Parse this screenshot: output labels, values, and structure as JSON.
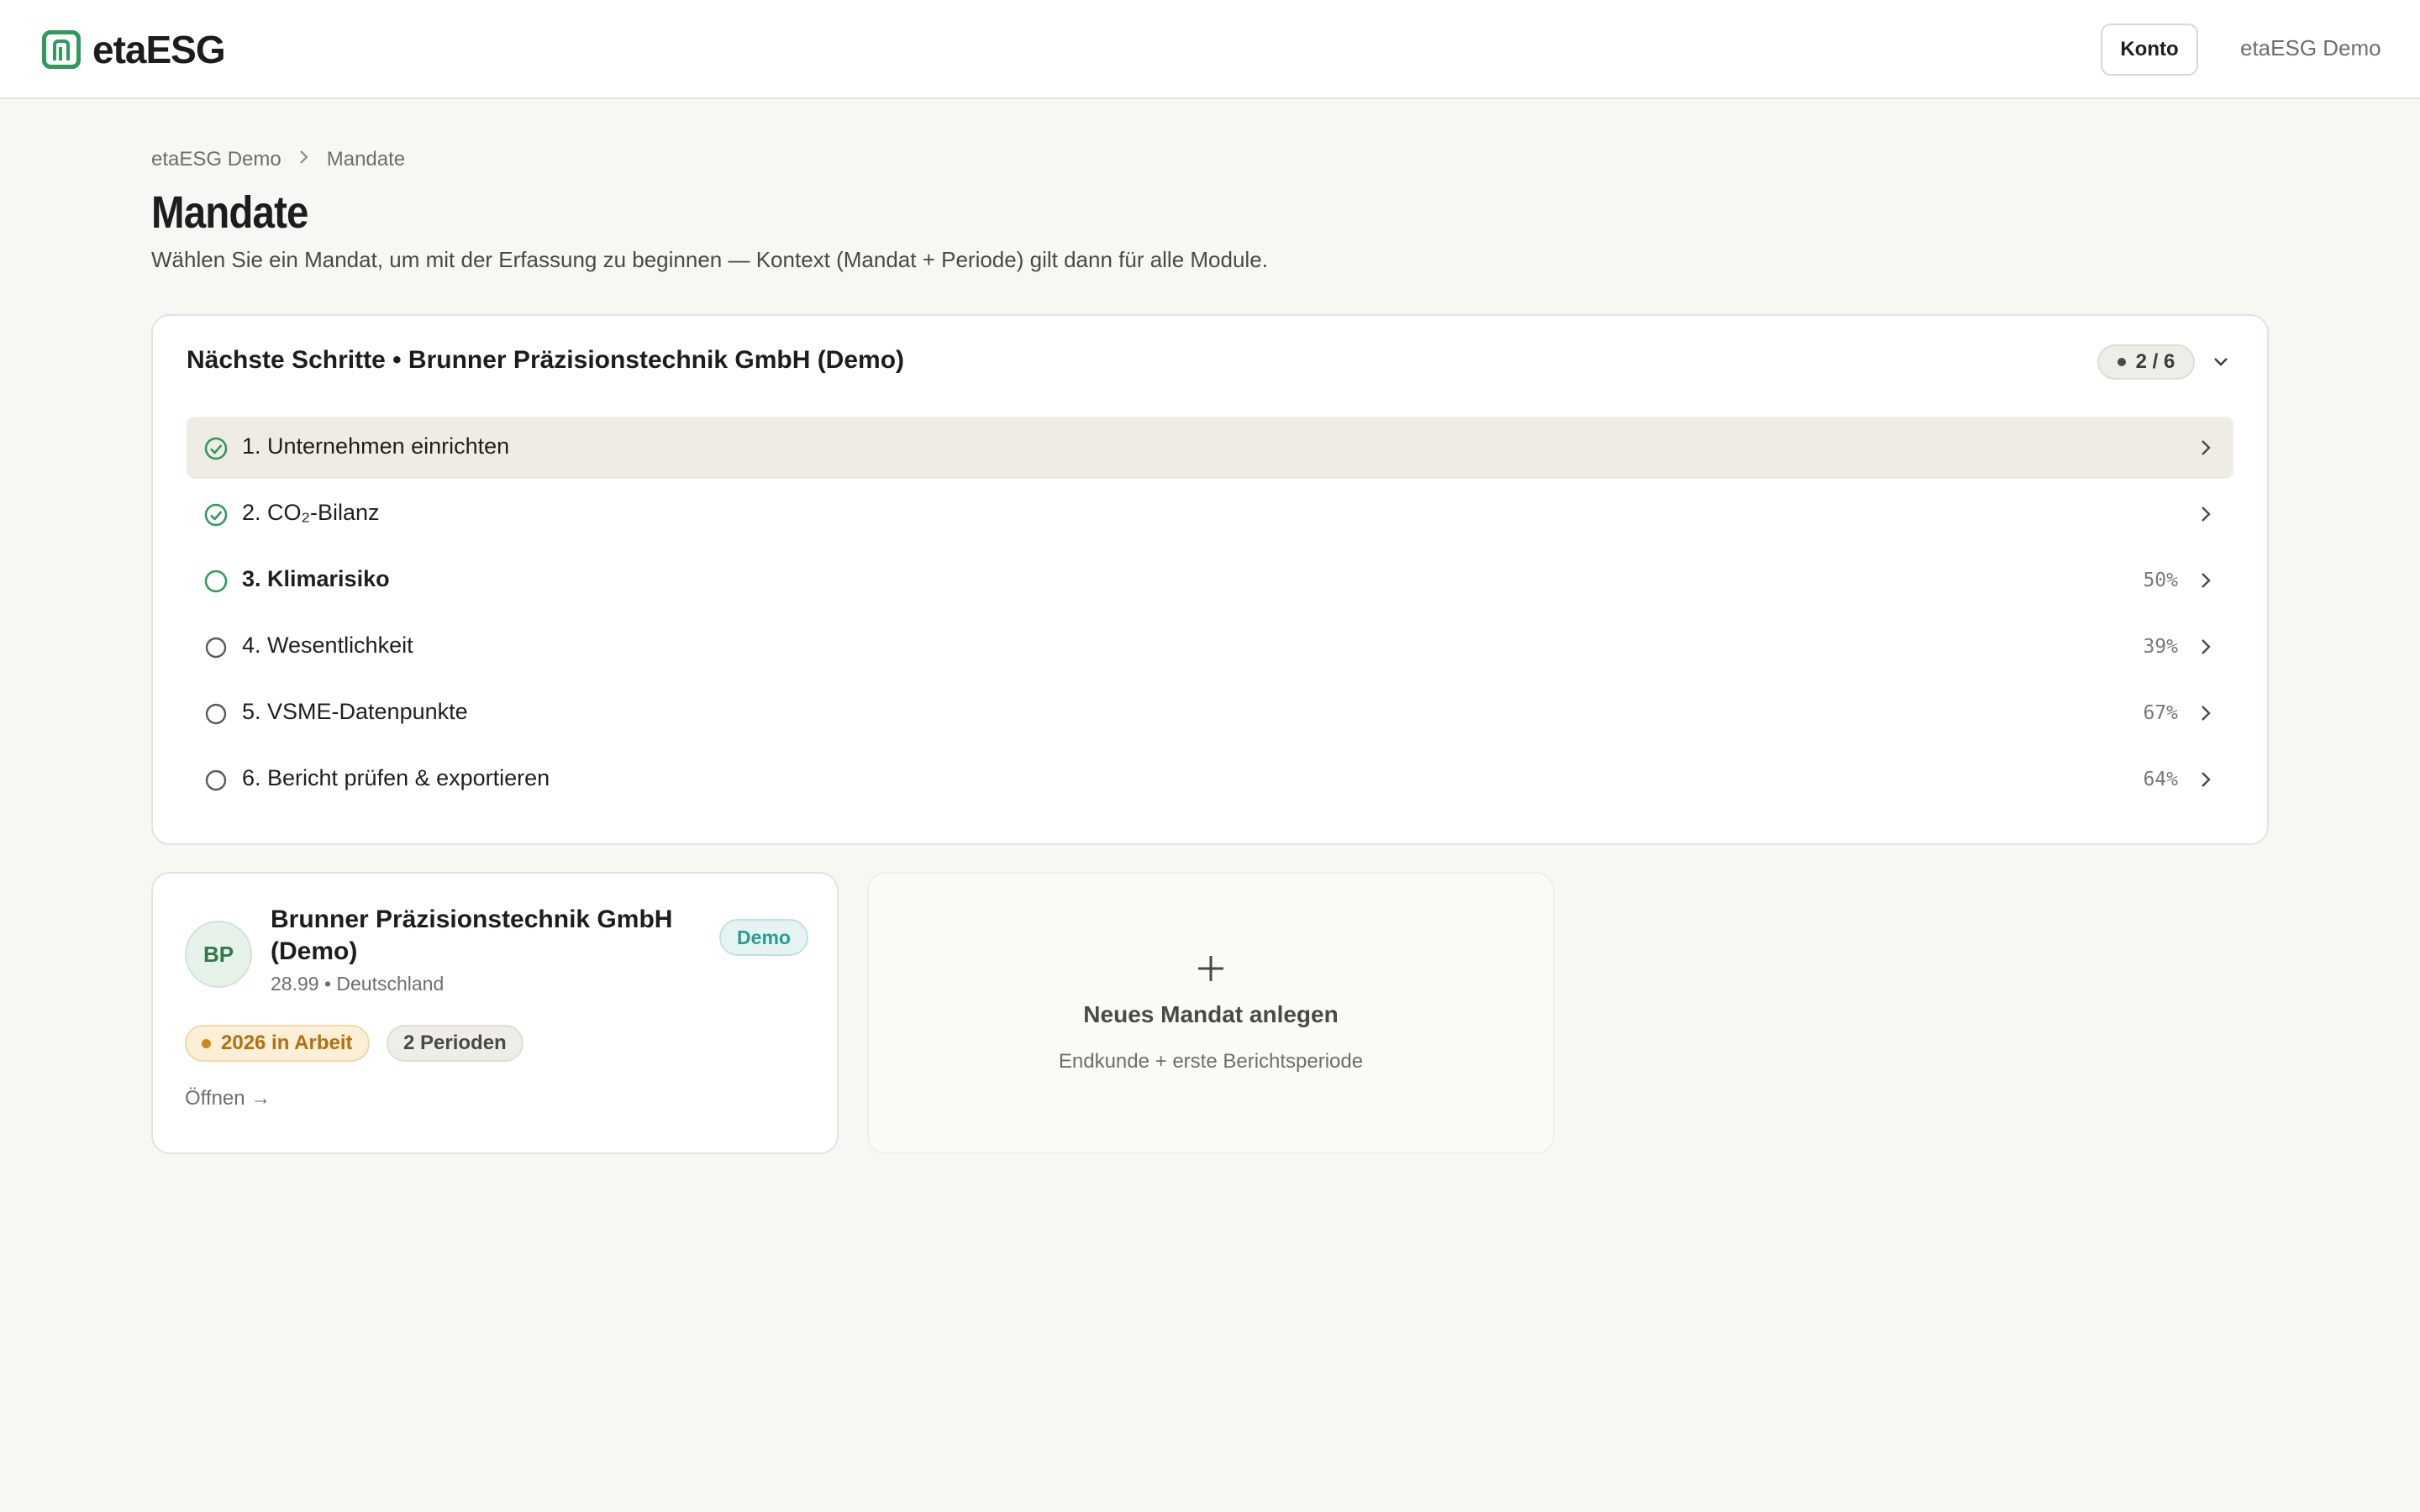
{
  "header": {
    "brand_name": "etaESG",
    "account_button": "Konto",
    "account_name": "etaESG Demo"
  },
  "breadcrumb": {
    "items": [
      "etaESG Demo",
      "Mandate"
    ]
  },
  "page": {
    "title": "Mandate",
    "subtitle": "Wählen Sie ein Mandat, um mit der Erfassung zu beginnen — Kontext (Mandat + Periode) gilt dann für alle Module."
  },
  "next_steps": {
    "title": "Nächste Schritte • Brunner Präzisionstechnik GmbH (Demo)",
    "progress": "2 / 6",
    "steps": [
      {
        "label": "1. Unternehmen einrichten",
        "status": "done",
        "percent": ""
      },
      {
        "label": "2. CO₂-Bilanz",
        "status": "done",
        "percent": ""
      },
      {
        "label": "3. Klimarisiko",
        "status": "current",
        "percent": "50%"
      },
      {
        "label": "4. Wesentlichkeit",
        "status": "open",
        "percent": "39%"
      },
      {
        "label": "5. VSME-Datenpunkte",
        "status": "open",
        "percent": "67%"
      },
      {
        "label": "6. Bericht prüfen & exportieren",
        "status": "open",
        "percent": "64%"
      }
    ]
  },
  "client_card": {
    "initials": "BP",
    "name": "Brunner Präzisionstechnik GmbH (Demo)",
    "meta": "28.99 • Deutschland",
    "demo_badge": "Demo",
    "status_badge": "2026 in Arbeit",
    "periods_badge": "2 Perioden",
    "open_link": "Öffnen →"
  },
  "new_client": {
    "title": "Neues Mandat anlegen",
    "subtitle": "Endkunde + erste Berichtsperiode"
  },
  "colors": {
    "brand_green": "#2f9a5c",
    "accent_teal": "#2a9c95",
    "status_amber": "#b3700f",
    "background": "#f8f7f3"
  },
  "icons": {
    "logo": "brand-logo-icon",
    "breadcrumb_sep": "chevron-right-icon",
    "collapse": "chevron-down-icon",
    "step_done": "check-circle-icon",
    "step_open": "circle-icon",
    "row_chevron": "chevron-right-icon",
    "new": "plus-icon"
  }
}
